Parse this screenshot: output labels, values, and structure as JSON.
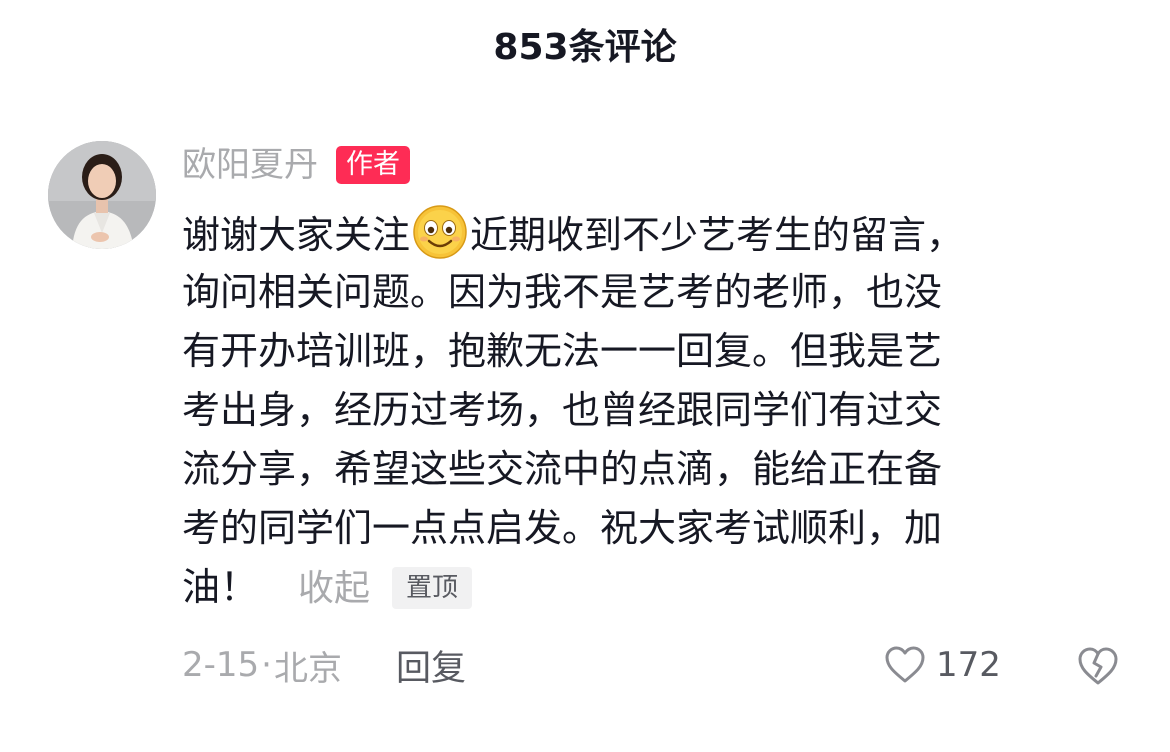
{
  "header": {
    "title": "853条评论"
  },
  "comment": {
    "author_name": "欧阳夏丹",
    "author_badge": "作者",
    "body_lines": [
      {
        "before": "谢谢大家关注",
        "emoji": "smiling-face-emoji",
        "after": "近期收到不少艺考生的留言，"
      },
      {
        "text": "询问相关问题。因为我不是艺考的老师，也没"
      },
      {
        "text": "有开办培训班，抱歉无法一一回复。但我是艺"
      },
      {
        "text": "考出身，经历过考场，也曾经跟同学们有过交"
      },
      {
        "text": "流分享，希望这些交流中的点滴，能给正在备"
      },
      {
        "text": "考的同学们一点点启发。祝大家考试顺利，加"
      },
      {
        "text": "油！"
      }
    ],
    "collapse_label": "收起",
    "pinned_label": "置顶",
    "date": "2-15",
    "dot": "·",
    "location": "北京",
    "reply_label": "回复",
    "like_count": "172",
    "like_icon": "heart-outline-icon",
    "dislike_icon": "broken-heart-icon"
  },
  "colors": {
    "badge": "#fe2c55",
    "text_primary": "#161823",
    "text_muted": "#a9aaad",
    "text_secondary": "#585a61"
  }
}
